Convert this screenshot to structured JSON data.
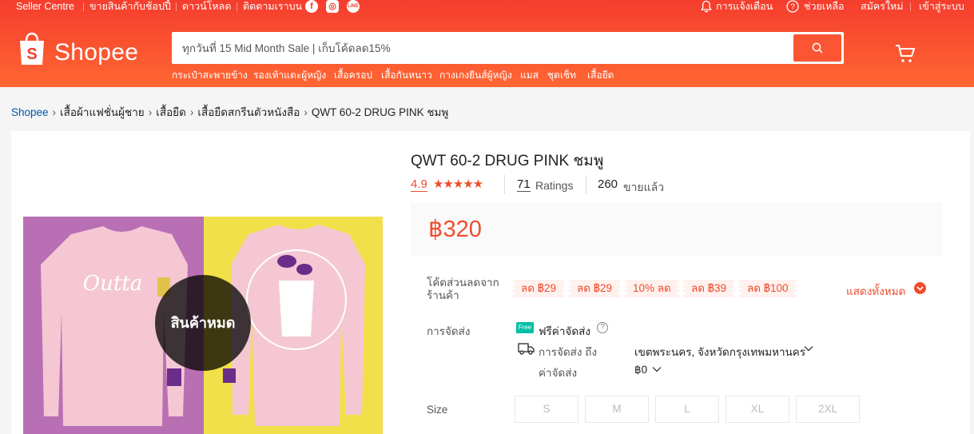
{
  "topbar": {
    "seller_centre": "Seller Centre",
    "sell_with_shopee": "ขายสินค้ากับช้อปปี้",
    "download": "ดาวน์โหลด",
    "follow_us": "ติดตามเราบน",
    "notifications": "การแจ้งเตือน",
    "help": "ช่วยเหลือ",
    "signup": "สมัครใหม่",
    "login": "เข้าสู่ระบบ"
  },
  "logo": {
    "text": "Shopee"
  },
  "search": {
    "placeholder": "ทุกวันที่ 15 Mid Month Sale | เก็บโค้ดลด15%"
  },
  "categories": [
    "กระเป๋าสะพายข้าง",
    "รองเท้าแตะผู้หญิง",
    "เสื้อครอป",
    "เสื้อกันหนาว",
    "กางเกงยีนส์ผู้หญิง",
    "แมส",
    "ชุดเซ็ท",
    "เสื้อยืด"
  ],
  "breadcrumb": [
    "Shopee",
    "เสื้อผ้าแฟชั่นผู้ชาย",
    "เสื้อยืด",
    "เสื้อยืดสกรีนตัวหนังสือ",
    "QWT 60-2 DRUG PINK ชมพู"
  ],
  "product": {
    "title": "QWT 60-2 DRUG PINK ชมพู",
    "rating": "4.9",
    "stars": "★★★★★",
    "ratings_count": "71",
    "ratings_label": "Ratings",
    "sold_count": "260",
    "sold_label": "ขายแล้ว",
    "price": "฿320",
    "sold_out_overlay": "สินค้าหมด"
  },
  "vouchers": {
    "label": "โค้ดส่วนลดจากร้านค้า",
    "items": [
      "ลด ฿29",
      "ลด ฿29",
      "10% ลด",
      "ลด ฿39",
      "ลด ฿100"
    ],
    "show_all": "แสดงทั้งหมด"
  },
  "shipping": {
    "label": "การจัดส่ง",
    "free_badge": "Free",
    "free_text": "ฟรีค่าจัดส่ง",
    "ship_to_label": "การจัดส่ง ถึง",
    "ship_to_value": "เขตพระนคร, จังหวัดกรุงเทพมหานคร",
    "fee_label": "ค่าจัดส่ง",
    "fee_value": "฿0"
  },
  "size": {
    "label": "Size",
    "options": [
      "S",
      "M",
      "L",
      "XL",
      "2XL"
    ]
  },
  "colors": {
    "brand": "#ee4d2d",
    "header": "#f53d2d",
    "free_badge": "#00bfa5"
  }
}
